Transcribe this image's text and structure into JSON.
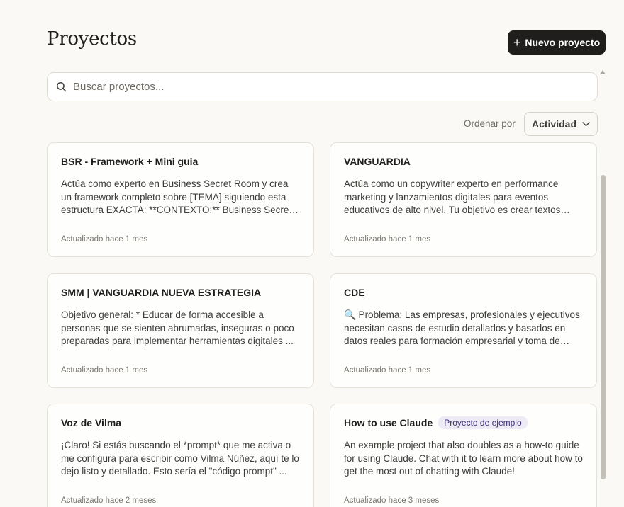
{
  "header": {
    "title": "Proyectos",
    "new_button_label": "Nuevo proyecto",
    "new_button_icon": "plus-icon"
  },
  "search": {
    "placeholder": "Buscar proyectos...",
    "value": ""
  },
  "sort": {
    "label": "Ordenar por",
    "selected": "Actividad"
  },
  "projects": [
    {
      "title": "BSR - Framework + Mini guia",
      "description": "Actúa como experto en Business Secret Room y crea un framework completo sobre [TEMA] siguiendo esta estructura EXACTA: **CONTEXTO:** Business Secret Room ...",
      "updated": "Actualizado hace 1 mes"
    },
    {
      "title": "VANGUARDIA",
      "description": "Actúa como un copywriter experto en performance marketing y lanzamientos digitales para eventos educativos de alto nivel. Tu objetivo es crear textos persuasivos ...",
      "updated": "Actualizado hace 1 mes"
    },
    {
      "title": "SMM | VANGUARDIA NUEVA ESTRATEGIA",
      "description": "Objetivo general: * Educar de forma accesible a personas que se sienten abrumadas, inseguras o poco preparadas para implementar herramientas digitales ...",
      "updated": "Actualizado hace 1 mes"
    },
    {
      "title": "CDE",
      "description": "🔍 Problema: Las empresas, profesionales y ejecutivos necesitan casos de estudio detallados y basados en datos reales para formación empresarial y toma de decisiones ...",
      "updated": "Actualizado hace 1 mes"
    },
    {
      "title": "Voz de Vilma",
      "description": "¡Claro! Si estás buscando el *prompt* que me activa o me configura para escribir como Vilma Núñez, aquí te lo dejo listo y detallado. Esto sería el \"código prompt\" ...",
      "updated": "Actualizado hace 2 meses"
    },
    {
      "title": "How to use Claude",
      "badge": "Proyecto de ejemplo",
      "description": "An example project that also doubles as a how-to guide for using Claude. Chat with it to learn more about how to get the most out of chatting with Claude!",
      "updated": "Actualizado hace 3 meses"
    }
  ],
  "colors": {
    "background": "#faf9f5",
    "primary_button": "#1f1e1d",
    "badge_bg": "#eeebf7",
    "badge_text": "#3b2f75"
  }
}
